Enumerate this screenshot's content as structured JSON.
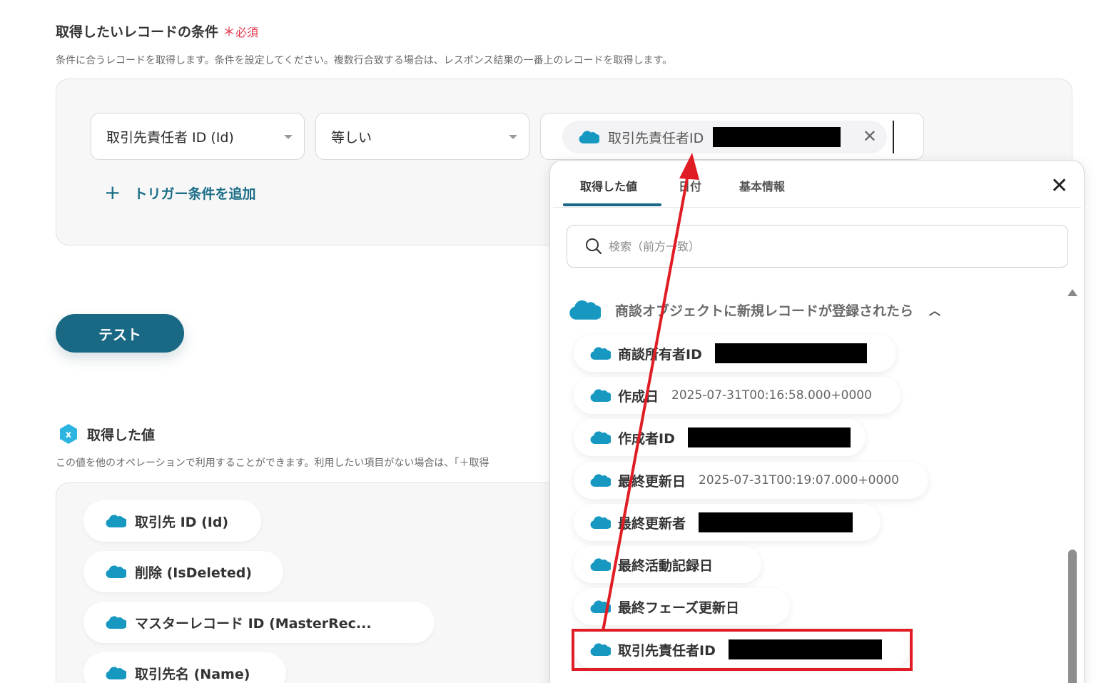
{
  "conditions": {
    "title": "取得したいレコードの条件",
    "required_mark": "＊",
    "required_label": "必須",
    "description": "条件に合うレコードを取得します。条件を設定してください。複数行合致する場合は、レスポンス結果の一番上のレコードを取得します。",
    "field_select": "取引先責任者 ID (Id)",
    "operator_select": "等しい",
    "value_chip": {
      "label": "取引先責任者ID",
      "icon": "salesforce-cloud-icon"
    },
    "add_trigger_label": "トリガー条件を追加"
  },
  "test_button": "テスト",
  "obtained": {
    "title": "取得した値",
    "description": "この値を他のオペレーションで利用することができます。利用したい項目がない場合は、「＋取得",
    "items": [
      {
        "label": "取引先 ID (Id)"
      },
      {
        "label": "削除 (IsDeleted)"
      },
      {
        "label": "マスターレコード ID (MasterRec..."
      },
      {
        "label": "取引先名 (Name)"
      }
    ]
  },
  "picker": {
    "tabs": [
      "取得した値",
      "日付",
      "基本情報"
    ],
    "active_tab": "取得した値",
    "search_placeholder": "検索（前方一致）",
    "group_title": "商談オブジェクトに新規レコードが登録されたら",
    "items": [
      {
        "label": "商談所有者ID",
        "value": "",
        "redacted": true
      },
      {
        "label": "作成日",
        "value": "2025-07-31T00:16:58.000+0000",
        "redacted": false
      },
      {
        "label": "作成者ID",
        "value": "",
        "redacted": true
      },
      {
        "label": "最終更新日",
        "value": "2025-07-31T00:19:07.000+0000",
        "redacted": false
      },
      {
        "label": "最終更新者",
        "value": "",
        "redacted": true
      },
      {
        "label": "最終活動記録日",
        "value": "",
        "redacted": false
      },
      {
        "label": "最終フェーズ更新日",
        "value": "",
        "redacted": false
      },
      {
        "label": "取引先責任者ID",
        "value": "",
        "redacted": true
      }
    ]
  },
  "colors": {
    "brand_teal": "#1a6984",
    "salesforce_blue": "#1798c1",
    "annotation_red": "#e01d25",
    "required_red": "#e5354b"
  }
}
